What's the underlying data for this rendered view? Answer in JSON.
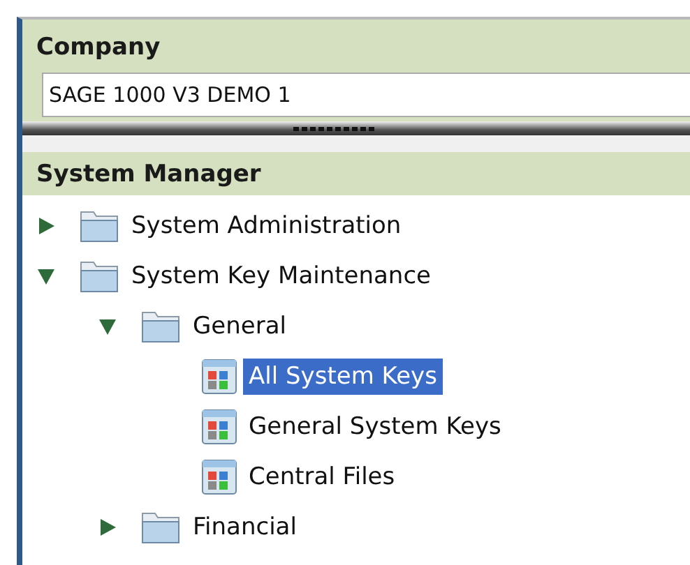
{
  "company": {
    "title": "Company",
    "value": "SAGE 1000 V3 DEMO 1"
  },
  "system_manager": {
    "title": "System Manager",
    "tree": [
      {
        "label": "System Administration",
        "kind": "folder",
        "expanded": false,
        "selected": false
      },
      {
        "label": "System Key Maintenance",
        "kind": "folder",
        "expanded": true,
        "selected": false,
        "children": [
          {
            "label": "General",
            "kind": "folder",
            "expanded": true,
            "selected": false,
            "children": [
              {
                "label": "All System Keys",
                "kind": "item",
                "selected": true
              },
              {
                "label": "General System Keys",
                "kind": "item",
                "selected": false
              },
              {
                "label": "Central Files",
                "kind": "item",
                "selected": false
              }
            ]
          },
          {
            "label": "Financial",
            "kind": "folder",
            "expanded": false,
            "selected": false
          }
        ]
      }
    ]
  }
}
